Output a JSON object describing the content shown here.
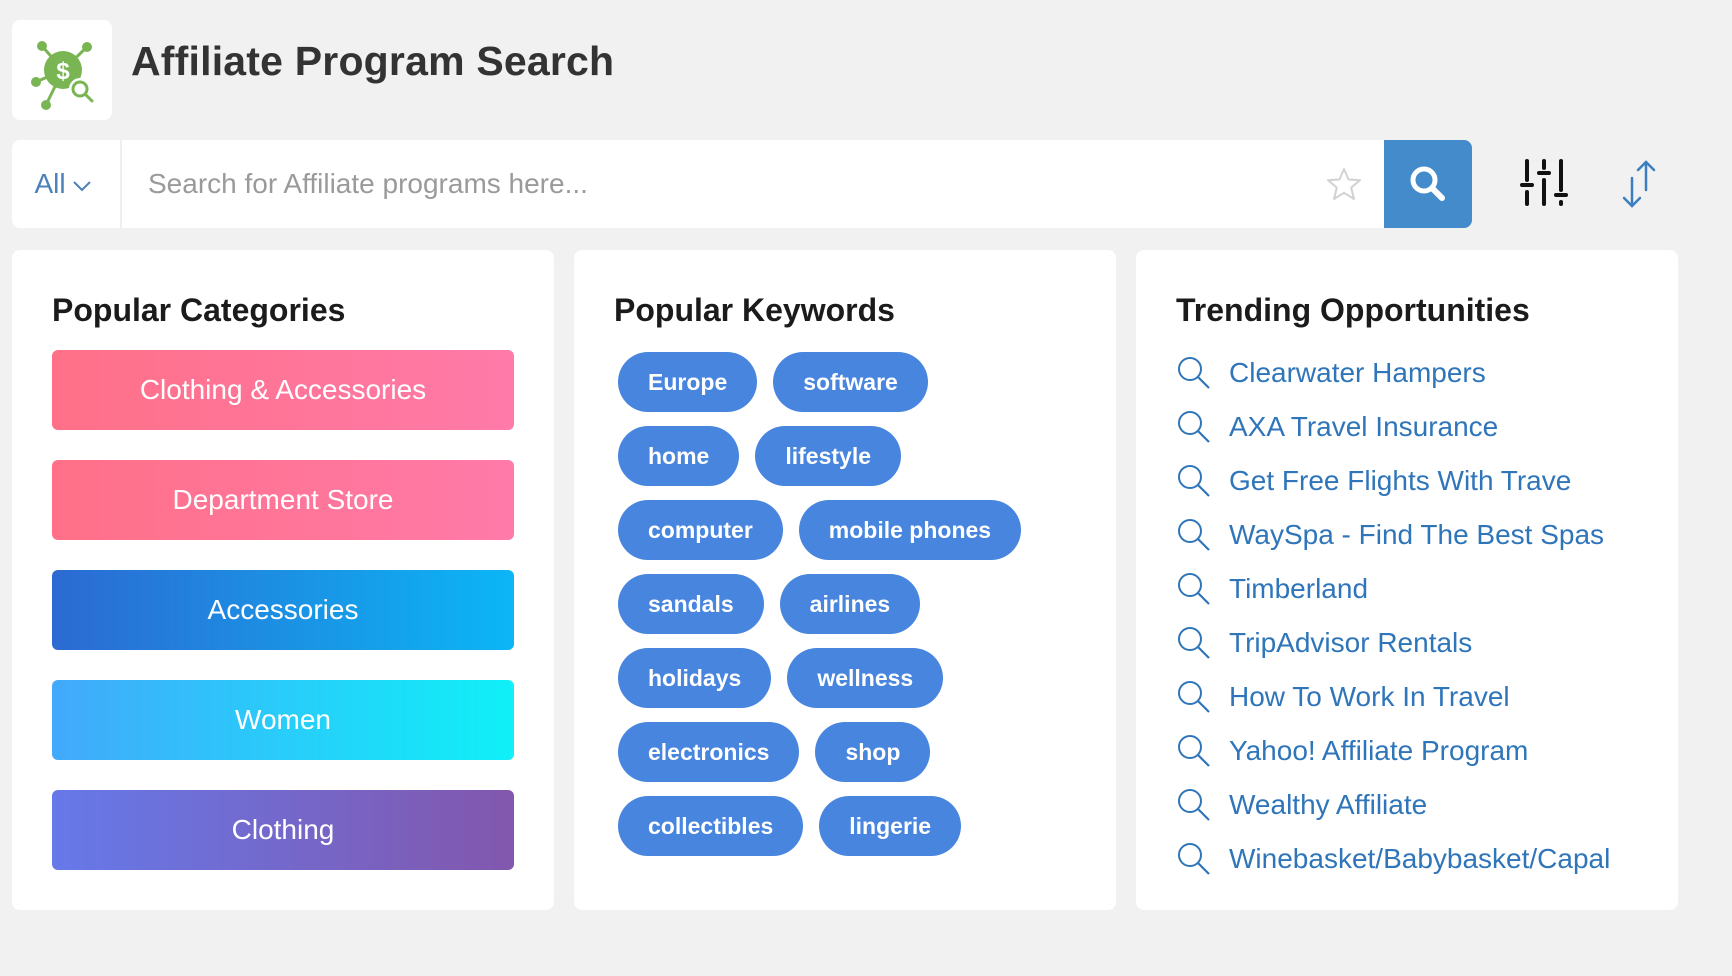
{
  "app": {
    "title": "Affiliate Program Search",
    "logo_icon": "dollar-network-search-icon",
    "brand_color": "#79b553"
  },
  "search": {
    "scope_label": "All",
    "scope_icon": "chevron-down-icon",
    "placeholder": "Search for Affiliate programs here...",
    "value": "",
    "favorite_icon": "star-icon",
    "submit_icon": "search-icon",
    "submit_color": "#438bcb",
    "filter_icon": "sliders-icon",
    "sort_icon": "sort-arrows-icon"
  },
  "categories": {
    "title": "Popular Categories",
    "items": [
      {
        "label": "Clothing & Accessories",
        "gradient": [
          "#ff7088",
          "#ff7aa9"
        ]
      },
      {
        "label": "Department Store",
        "gradient": [
          "#ff7088",
          "#ff7aa9"
        ]
      },
      {
        "label": "Accessories",
        "gradient": [
          "#2c6ad1",
          "#0bb6f6"
        ]
      },
      {
        "label": "Women",
        "gradient": [
          "#42a9fb",
          "#0ff0f8"
        ]
      },
      {
        "label": "Clothing",
        "gradient": [
          "#6679e9",
          "#8257ad"
        ]
      }
    ]
  },
  "keywords": {
    "title": "Popular Keywords",
    "color": "#4785de",
    "rows": [
      [
        "Europe",
        "software"
      ],
      [
        "home",
        "lifestyle"
      ],
      [
        "computer",
        "mobile phones"
      ],
      [
        "sandals",
        "airlines"
      ],
      [
        "holidays",
        "wellness"
      ],
      [
        "electronics",
        "shop"
      ],
      [
        "collectibles",
        "lingerie"
      ]
    ]
  },
  "trending": {
    "title": "Trending Opportunities",
    "item_icon": "search-icon",
    "color": "#2f75b9",
    "items": [
      "Clearwater Hampers",
      "AXA Travel Insurance",
      "Get Free Flights With Trave",
      "WaySpa - Find The Best Spas",
      "Timberland",
      "TripAdvisor Rentals",
      "How To Work In Travel",
      "Yahoo! Affiliate Program",
      "Wealthy Affiliate",
      "Winebasket/Babybasket/Capal"
    ]
  }
}
